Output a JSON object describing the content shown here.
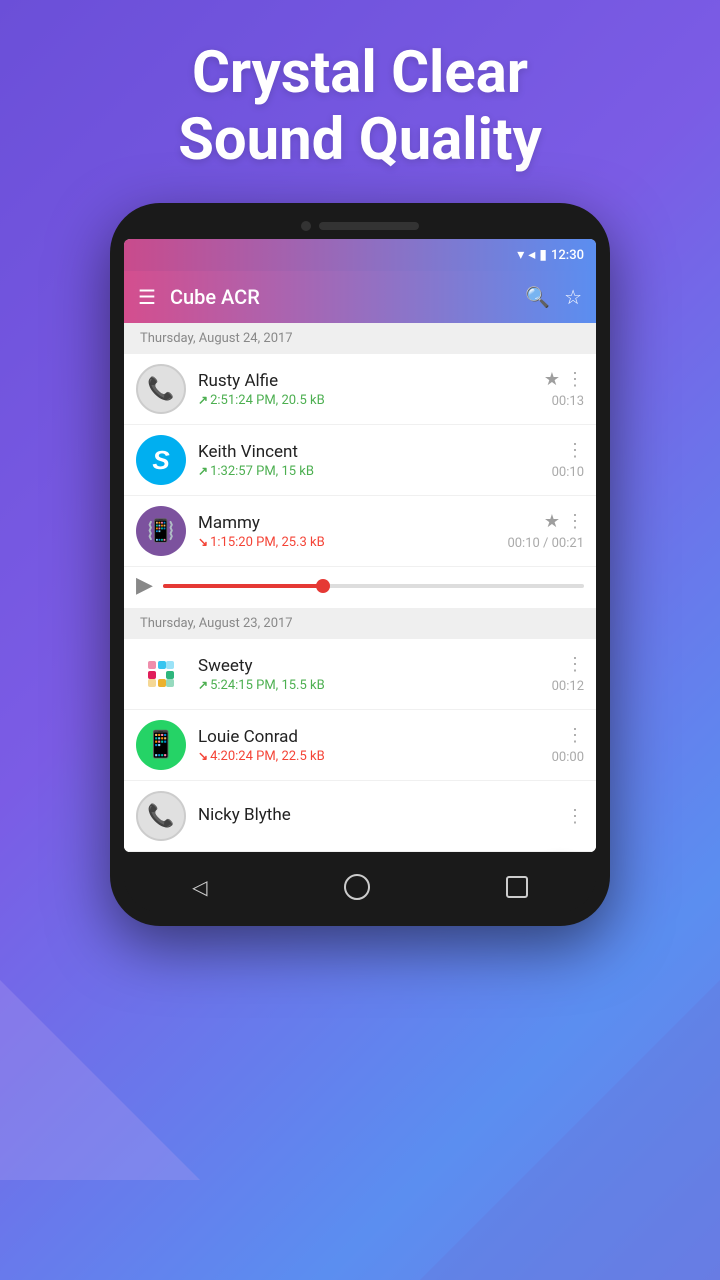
{
  "header": {
    "line1": "Crystal Clear",
    "line2": "Sound Quality"
  },
  "status_bar": {
    "time": "12:30"
  },
  "toolbar": {
    "title": "Cube ACR"
  },
  "sections": [
    {
      "date": "Thursday, August 24, 2017",
      "items": [
        {
          "name": "Rusty Alfie",
          "avatar_type": "phone",
          "direction": "outgoing",
          "detail": "2:51:24 PM, 20.5 kB",
          "duration": "00:13",
          "starred": true,
          "has_star": true
        },
        {
          "name": "Keith Vincent",
          "avatar_type": "skype",
          "direction": "outgoing",
          "detail": "1:32:57 PM, 15 kB",
          "duration": "00:10",
          "starred": false,
          "has_star": false
        },
        {
          "name": "Mammy",
          "avatar_type": "viber",
          "direction": "incoming",
          "detail": "1:15:20 PM, 25.3 kB",
          "duration": "00:10 / 00:21",
          "starred": true,
          "has_star": true,
          "active": true
        }
      ]
    },
    {
      "date": "Thursday, August 23, 2017",
      "items": [
        {
          "name": "Sweety",
          "avatar_type": "slack",
          "direction": "outgoing",
          "detail": "5:24:15 PM, 15.5 kB",
          "duration": "00:12",
          "starred": false,
          "has_star": false
        },
        {
          "name": "Louie Conrad",
          "avatar_type": "whatsapp",
          "direction": "incoming",
          "detail": "4:20:24 PM, 22.5 kB",
          "duration": "00:00",
          "starred": false,
          "has_star": false
        },
        {
          "name": "Nicky Blythe",
          "avatar_type": "phone",
          "direction": "outgoing",
          "detail": "",
          "duration": "",
          "starred": false,
          "has_star": false
        }
      ]
    }
  ],
  "fab": {
    "label": "mic"
  },
  "nav": {
    "back": "◁",
    "home": "○",
    "recent": "□"
  }
}
